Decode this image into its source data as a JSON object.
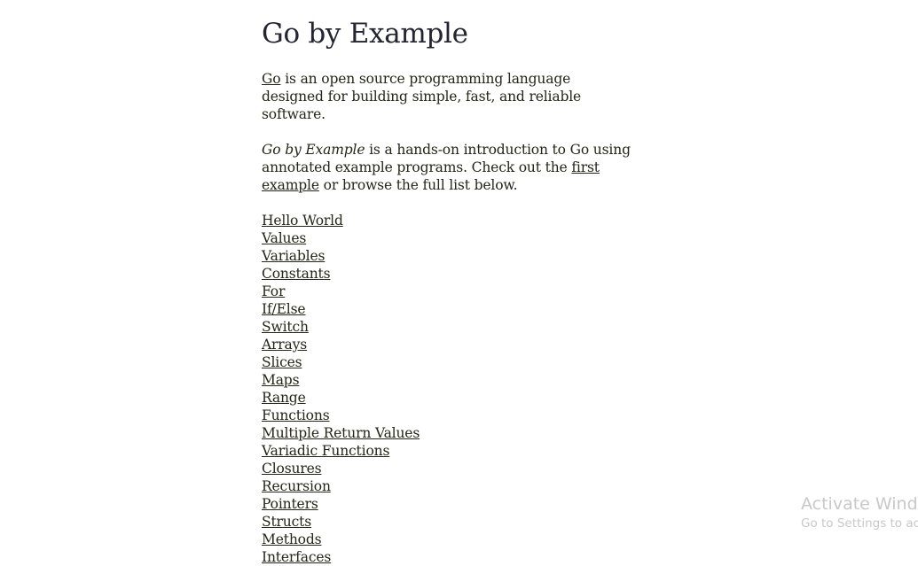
{
  "page": {
    "title": "Go by Example",
    "intro": {
      "go_link": "Go",
      "line1_rest": " is an open source programming language designed for building simple, fast, and reliable software.",
      "gbe_italic": "Go by Example",
      "line2_mid": " is a hands-on introduction to Go using annotated example programs. Check out the ",
      "first_example_link": "first example",
      "line2_end": " or browse the full list below."
    },
    "examples": [
      "Hello World",
      "Values",
      "Variables",
      "Constants",
      "For",
      "If/Else",
      "Switch",
      "Arrays",
      "Slices",
      "Maps",
      "Range",
      "Functions",
      "Multiple Return Values",
      "Variadic Functions",
      "Closures",
      "Recursion",
      "Pointers",
      "Structs",
      "Methods",
      "Interfaces"
    ]
  },
  "watermark": {
    "title": "Activate Windows",
    "subtitle": "Go to Settings to activate Windows."
  }
}
